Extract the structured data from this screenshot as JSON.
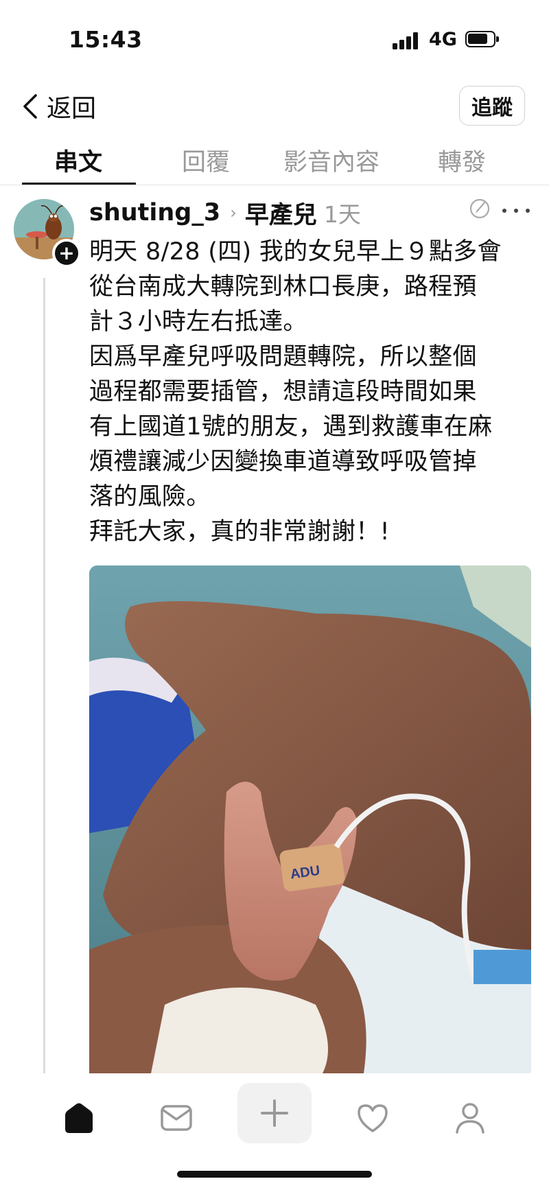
{
  "status_bar": {
    "time": "15:43",
    "network": "4G",
    "icons": [
      "signal-icon",
      "battery-icon"
    ]
  },
  "header": {
    "back_label": "返回",
    "follow_label": "追蹤",
    "icons": [
      "chevron-left-icon"
    ]
  },
  "tabs": [
    {
      "label": "串文",
      "active": true
    },
    {
      "label": "回覆",
      "active": false
    },
    {
      "label": "影音內容",
      "active": false
    },
    {
      "label": "轉發",
      "active": false
    }
  ],
  "post": {
    "username": "shuting_3",
    "topic": "早產兒",
    "timestamp": "1天",
    "follow_plus": "+",
    "body": [
      "明天 8/28 (四) 我的女兒早上９點多會",
      "從台南成大轉院到林口長庚，路程預",
      "計３小時左右抵達。",
      "因爲早產兒呼吸問題轉院，所以整個",
      "過程都需要插管，想請這段時間如果",
      "有上國道1號的朋友，遇到救護車在麻",
      "煩禮讓減少因變換車道導致呼吸管掉",
      "落的風險。",
      "拜託大家，真的非常謝謝！!"
    ],
    "photo_label": "ADU",
    "icons": [
      "avatar-cockroach-icon",
      "edit-icon",
      "more-icon"
    ]
  },
  "bottom_nav": {
    "items": [
      "home-icon",
      "inbox-icon",
      "plus-icon",
      "heart-icon",
      "profile-icon"
    ],
    "active": "home-icon"
  },
  "colors": {
    "text": "#111111",
    "muted": "#999999",
    "divider": "#e4e4e4",
    "create_bg": "#f1f1f1"
  }
}
